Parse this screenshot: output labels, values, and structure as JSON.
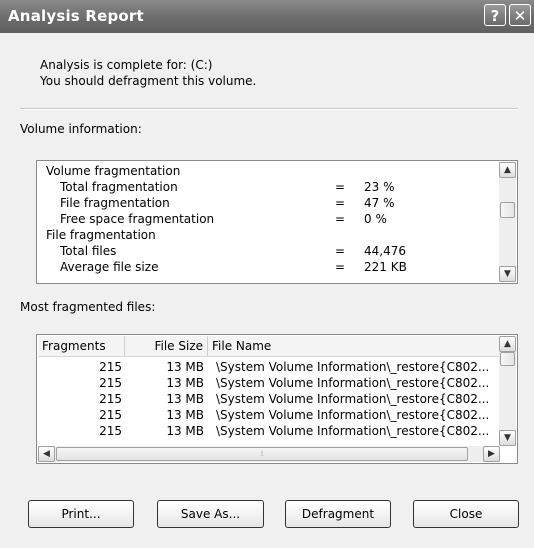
{
  "window": {
    "title": "Analysis Report",
    "help_glyph": "?",
    "close_glyph": "✕"
  },
  "summary": {
    "line1": "Analysis is complete for: (C:)",
    "line2": "You should defragment this volume."
  },
  "volume": {
    "label": "Volume information:",
    "rows": [
      {
        "label": "Volume fragmentation",
        "eq": "",
        "value": ""
      },
      {
        "label": "Total fragmentation",
        "eq": "=",
        "value": "23 %"
      },
      {
        "label": "File fragmentation",
        "eq": "=",
        "value": "47 %"
      },
      {
        "label": "Free space fragmentation",
        "eq": "=",
        "value": "0 %"
      },
      {
        "label": "File fragmentation",
        "eq": "",
        "value": ""
      },
      {
        "label": "Total files",
        "eq": "=",
        "value": "44,476"
      },
      {
        "label": "Average file size",
        "eq": "=",
        "value": "221 KB"
      }
    ]
  },
  "files": {
    "label": "Most fragmented files:",
    "headers": {
      "fragments": "Fragments",
      "size": "File Size",
      "name": "File Name"
    },
    "rows": [
      {
        "fragments": "215",
        "size": "13 MB",
        "name": "\\System Volume Information\\_restore{C802..."
      },
      {
        "fragments": "215",
        "size": "13 MB",
        "name": "\\System Volume Information\\_restore{C802..."
      },
      {
        "fragments": "215",
        "size": "13 MB",
        "name": "\\System Volume Information\\_restore{C802..."
      },
      {
        "fragments": "215",
        "size": "13 MB",
        "name": "\\System Volume Information\\_restore{C802..."
      },
      {
        "fragments": "215",
        "size": "13 MB",
        "name": "\\System Volume Information\\_restore{C802..."
      }
    ]
  },
  "buttons": {
    "print": "Print...",
    "save_as": "Save As...",
    "defragment": "Defragment",
    "close": "Close"
  }
}
